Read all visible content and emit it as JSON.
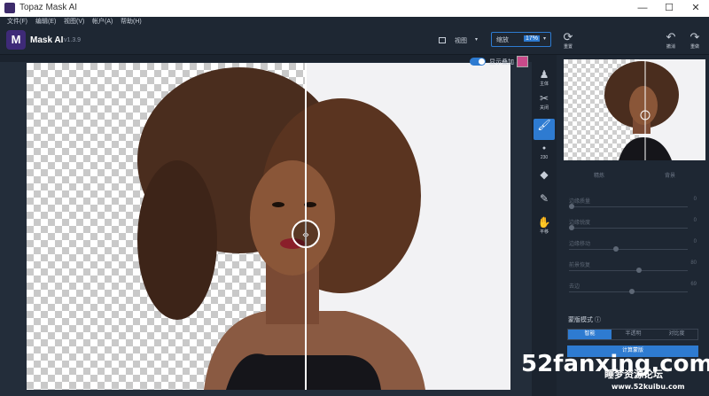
{
  "window": {
    "title": "Topaz Mask AI",
    "minimize": "—",
    "maximize": "☐",
    "close": "✕"
  },
  "menu": [
    {
      "label": "文件(F)"
    },
    {
      "label": "编辑(E)"
    },
    {
      "label": "视图(V)"
    },
    {
      "label": "帐户(A)"
    },
    {
      "label": "帮助(H)"
    }
  ],
  "toolbar": {
    "logo_letter": "M",
    "app_name": "Mask AI",
    "version": "v1.3.9",
    "view_label": "视图",
    "zoom_label": "缩放",
    "zoom_value": "17%",
    "reset_label": "重置",
    "undo_label": "撤消",
    "redo_label": "重做"
  },
  "canvas": {
    "overlay_label": "显示叠加"
  },
  "tools": [
    {
      "icon": "person-icon",
      "label": "主体"
    },
    {
      "icon": "cut-icon",
      "label": "关闭"
    },
    {
      "icon": "brush-icon",
      "label": ""
    },
    {
      "icon": "size-icon",
      "label": "230"
    },
    {
      "icon": "fill-icon",
      "label": ""
    },
    {
      "icon": "eyedropper-icon",
      "label": ""
    },
    {
      "icon": "hand-icon",
      "label": "平移"
    }
  ],
  "panel": {
    "tab_left": "精炼",
    "tab_right": "背景",
    "sliders": [
      {
        "label": "边缘质量",
        "value": "0"
      },
      {
        "label": "边缘锐度",
        "value": "0"
      },
      {
        "label": "边缘移动",
        "value": "0"
      },
      {
        "label": "前景恢复",
        "value": "80"
      },
      {
        "label": "去边",
        "value": "69"
      }
    ],
    "mask_mode_label": "蒙版模式 ⓘ",
    "mask_modes": [
      "智能",
      "半透明",
      "对比度"
    ],
    "compute_label": "计算蒙版"
  },
  "watermark": {
    "main": "52fanxing.com",
    "cn": "睡梦资源论坛",
    "url": "www.52kuibu.com"
  }
}
